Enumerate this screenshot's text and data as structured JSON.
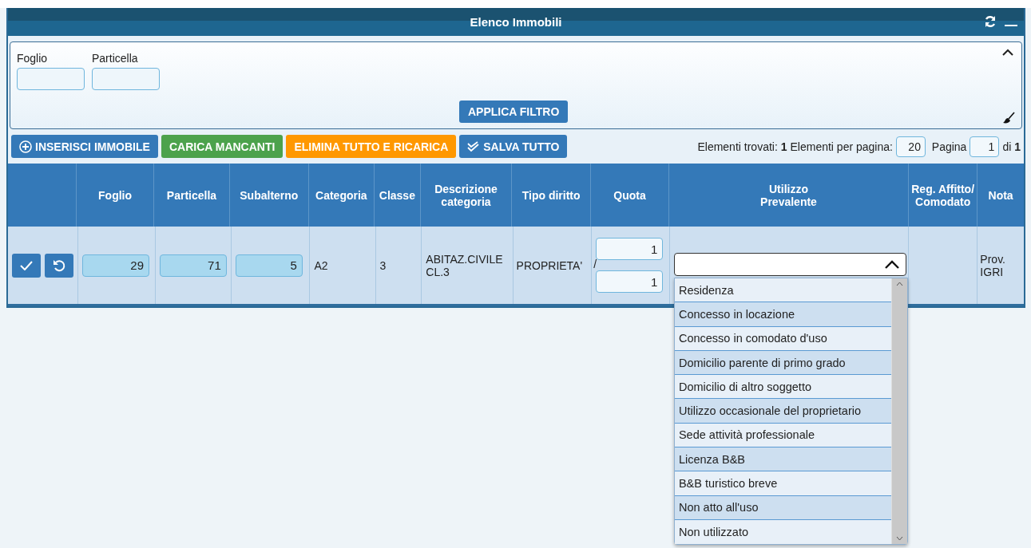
{
  "window": {
    "title": "Elenco Immobili"
  },
  "filter": {
    "expanded": true,
    "fields": [
      {
        "label": "Foglio"
      },
      {
        "label": "Particella"
      }
    ],
    "apply_button": "APPLICA FILTRO"
  },
  "toolbar": {
    "buttons": [
      {
        "label": "INSERISCI IMMOBILE",
        "kind": "insert"
      },
      {
        "label": "CARICA MANCANTI",
        "kind": "load"
      },
      {
        "label": "ELIMINA TUTTO E RICARICA",
        "kind": "reload"
      },
      {
        "label": "SALVA TUTTO",
        "kind": "save"
      }
    ],
    "found_label": "Elementi trovati:",
    "found": "1",
    "per_page_label": "Elementi per pagina:",
    "per_page": "20",
    "page_label": "Pagina",
    "page": "1",
    "of_label": "di",
    "pages": "1"
  },
  "table": {
    "columns": [
      "",
      "Foglio",
      "Particella",
      "Subalterno",
      "Categoria",
      "Classe",
      "Descrizione categoria",
      "Tipo diritto",
      "Quota",
      "Utilizzo Prevalente",
      "Reg. Affitto/ Comodato",
      "Nota"
    ],
    "rows": [
      {
        "foglio": "29",
        "particella": "71",
        "subalterno": "5",
        "categoria": "A2",
        "classe": "3",
        "descrizione": "ABITAZ.CIVILE CL.3",
        "tipo_diritto": "PROPRIETA'",
        "quota_num": "1",
        "quota_sep": "/",
        "quota_den": "1",
        "nota": "Prov. IGRI",
        "utilizzo": {
          "expanded": true,
          "options": [
            "Residenza",
            "Concesso in locazione",
            "Concesso in comodato d'uso",
            "Domicilio parente di primo grado",
            "Domicilio di altro soggetto",
            "Utilizzo occasionale del proprietario",
            "Sede attività professionale",
            "Licenza B&B",
            "B&B turistico breve",
            "Non atto all'uso",
            "Non utilizzato"
          ]
        }
      }
    ]
  }
}
